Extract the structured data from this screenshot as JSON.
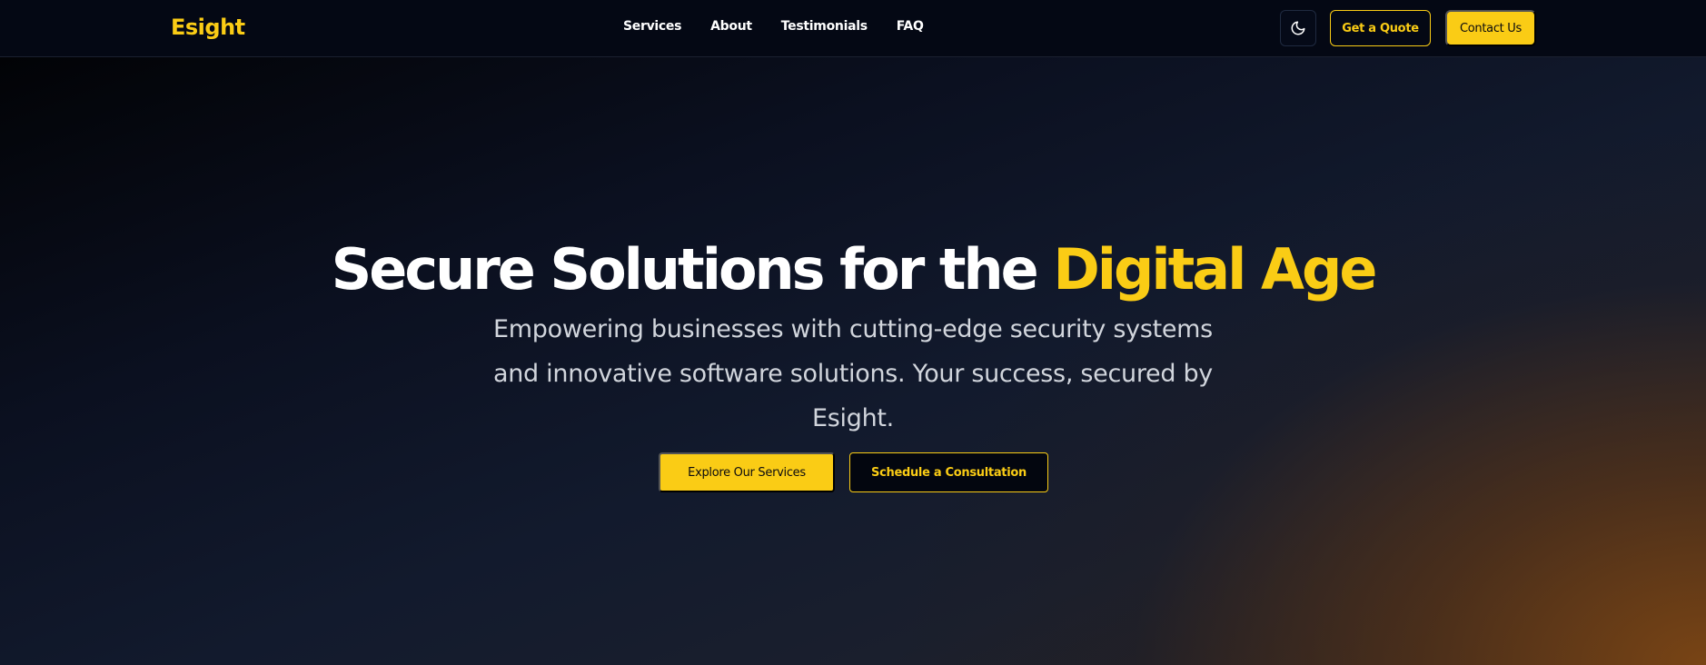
{
  "brand": {
    "logo_text": "Esight",
    "accent_color": "#facc15"
  },
  "nav": {
    "links": [
      {
        "label": "Services"
      },
      {
        "label": "About"
      },
      {
        "label": "Testimonials"
      },
      {
        "label": "FAQ"
      }
    ],
    "theme_toggle_icon": "moon-icon",
    "quote_button": "Get a Quote",
    "contact_button": "Contact Us"
  },
  "hero": {
    "title_main": "Secure Solutions for the ",
    "title_accent": "Digital Age",
    "subtitle": "Empowering businesses with cutting-edge security systems and innovative software solutions. Your success, secured by Esight.",
    "primary_button": "Explore Our Services",
    "secondary_button": "Schedule a Consultation"
  }
}
